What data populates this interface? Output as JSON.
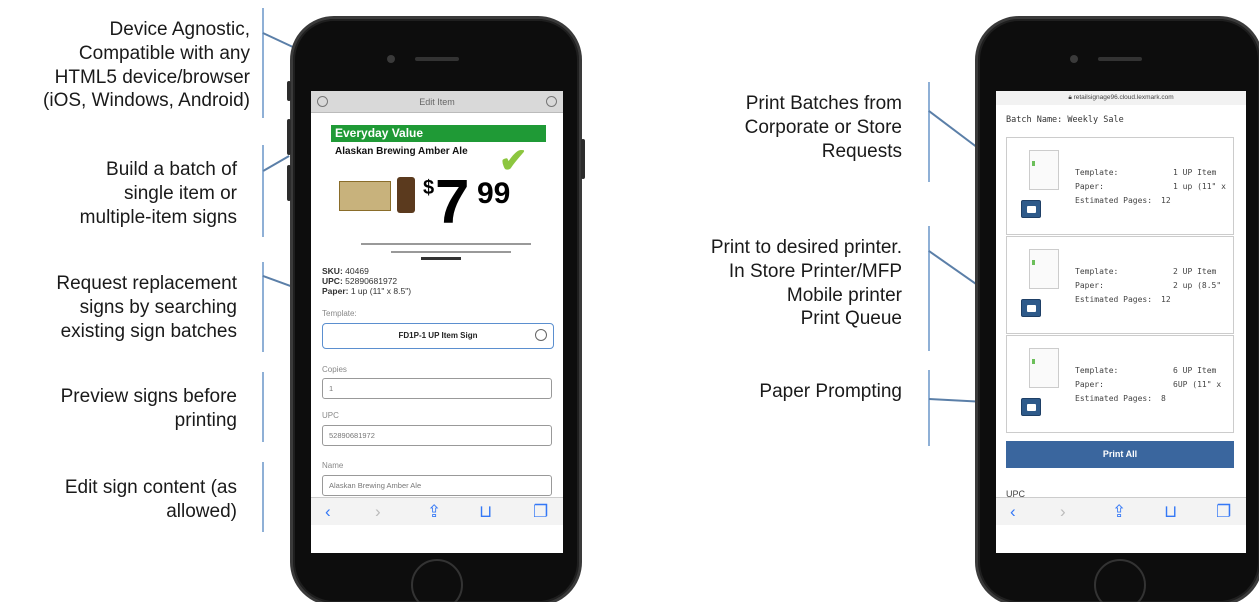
{
  "callouts_left": [
    {
      "text": "Device Agnostic,\nCompatible with any\nHTML5 device/browser\n(iOS, Windows, Android)"
    },
    {
      "text": "Build a batch of\nsingle item or\nmultiple-item signs"
    },
    {
      "text": "Request replacement\nsigns by searching\nexisting sign batches"
    },
    {
      "text": "Preview signs before\nprinting"
    },
    {
      "text": "Edit sign content (as\nallowed)"
    }
  ],
  "callouts_right": [
    {
      "text": "Print Batches from\nCorporate or Store\nRequests"
    },
    {
      "text": "Print to desired printer.\nIn Store Printer/MFP\nMobile printer\nPrint Queue"
    },
    {
      "text": "Paper Prompting"
    }
  ],
  "left_phone": {
    "nav_title": "Edit Item",
    "sign": {
      "banner": "Everyday Value",
      "product": "Alaskan Brewing Amber Ale",
      "dollar_sign": "$",
      "price_whole": "7",
      "price_cents": "99"
    },
    "details": {
      "sku_label": "SKU:",
      "sku": "40469",
      "upc_label": "UPC:",
      "upc": "52890681972",
      "paper_label": "Paper:",
      "paper": "1 up (11\" x 8.5\")"
    },
    "template_label": "Template:",
    "template_value": "FD1P-1 UP Item Sign",
    "copies_label": "Copies",
    "copies_value": "1",
    "upc_field_label": "UPC",
    "upc_field_value": "52890681972",
    "name_label": "Name",
    "name_value": "Alaskan Brewing Amber Ale"
  },
  "right_phone": {
    "url": "retailsignage96.cloud.lexmark.com",
    "batch_name": "Batch Name: Weekly Sale",
    "cards": [
      {
        "template_label": "Template:",
        "template": "1 UP Item",
        "paper_label": "Paper:",
        "paper": "1 up (11\" x",
        "pages_label": "Estimated Pages:",
        "pages": "12"
      },
      {
        "template_label": "Template:",
        "template": "2 UP Item",
        "paper_label": "Paper:",
        "paper": "2 up (8.5\"",
        "pages_label": "Estimated Pages:",
        "pages": "12"
      },
      {
        "template_label": "Template:",
        "template": "6 UP Item",
        "paper_label": "Paper:",
        "paper": "6UP (11\" x",
        "pages_label": "Estimated Pages:",
        "pages": "8"
      }
    ],
    "print_all": "Print All",
    "upc_label": "UPC"
  },
  "toolbar": {
    "back": "‹",
    "forward": "›",
    "share": "⇪",
    "bookmarks": "⊔",
    "tabs": "❐"
  },
  "colors": {
    "callout_line": "#8fb0d6",
    "banner_green": "#1f9a36",
    "print_blue": "#3a669e",
    "ios_blue": "#3478f6"
  }
}
